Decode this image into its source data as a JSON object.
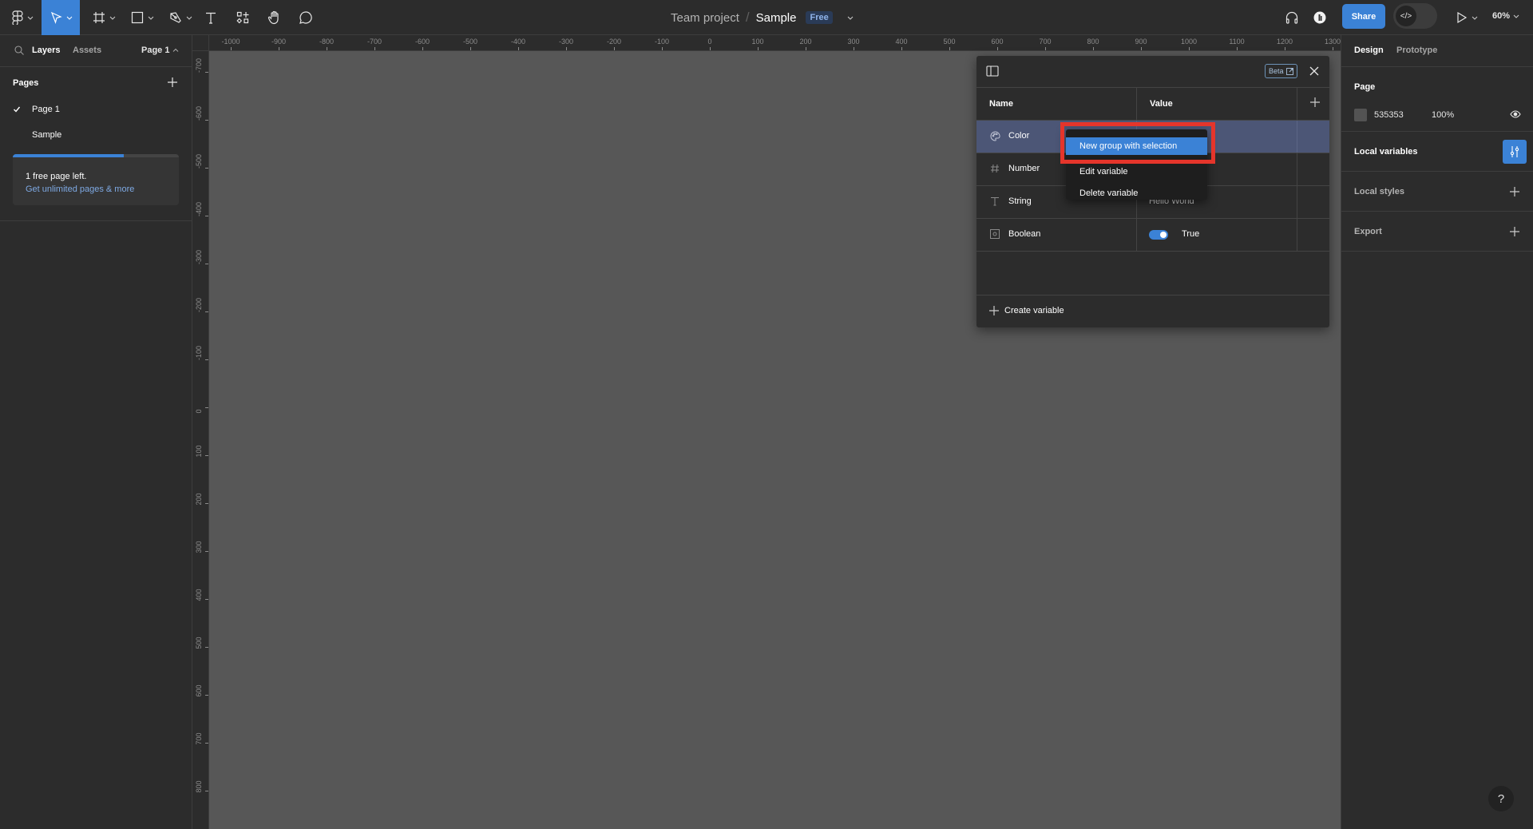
{
  "topbar": {
    "tools": [
      {
        "name": "main-menu",
        "icon": "figma-logo-icon"
      },
      {
        "name": "move",
        "icon": "move-cursor-icon",
        "active": true
      },
      {
        "name": "frame",
        "icon": "frame-icon"
      },
      {
        "name": "shape",
        "icon": "rectangle-icon"
      },
      {
        "name": "pen",
        "icon": "pen-icon"
      },
      {
        "name": "text",
        "icon": "text-icon"
      },
      {
        "name": "resources",
        "icon": "resources-icon"
      },
      {
        "name": "hand",
        "icon": "hand-icon"
      },
      {
        "name": "comment",
        "icon": "comment-icon"
      }
    ],
    "breadcrumb": {
      "project": "Team project",
      "separator": "/",
      "file": "Sample",
      "plan_badge": "Free"
    },
    "share_label": "Share",
    "devmode_icon": "</>",
    "zoom_level": "60%",
    "accent_color": "#3b82d6"
  },
  "left_panel": {
    "tabs": {
      "layers": "Layers",
      "assets": "Assets"
    },
    "current_page": "Page 1",
    "pages_heading": "Pages",
    "pages": [
      {
        "label": "Page 1",
        "selected": true
      },
      {
        "label": "Sample",
        "selected": false
      }
    ],
    "upsell": {
      "progress_fraction": 0.67,
      "line1": "1 free page left.",
      "line2": "Get unlimited pages & more"
    }
  },
  "rulers": {
    "horizontal": [
      "-1000",
      "-900",
      "-800",
      "-700",
      "-600",
      "-500",
      "-400",
      "-300",
      "-200",
      "-100",
      "0",
      "100",
      "200",
      "300",
      "400",
      "500",
      "600",
      "700",
      "800",
      "900",
      "1000",
      "1100",
      "1200",
      "1300"
    ],
    "vertical": [
      "-700",
      "-600",
      "-500",
      "-400",
      "-300",
      "-200",
      "-100",
      "0",
      "100",
      "200",
      "300",
      "400",
      "500",
      "600",
      "700",
      "800"
    ]
  },
  "variables_dialog": {
    "beta_label": "Beta",
    "columns": {
      "name": "Name",
      "value": "Value"
    },
    "rows": [
      {
        "type": "color",
        "icon": "palette-icon",
        "name": "Color",
        "value": "",
        "selected": true
      },
      {
        "type": "number",
        "icon": "hash-icon",
        "name": "Number",
        "value": ""
      },
      {
        "type": "string",
        "icon": "text-type-icon",
        "name": "String",
        "value": "Hello World"
      },
      {
        "type": "boolean",
        "icon": "boolean-icon",
        "name": "Boolean",
        "value": "True",
        "toggle_on": true
      }
    ],
    "create_label": "Create variable"
  },
  "context_menu": {
    "items": [
      {
        "label": "New group with selection",
        "highlighted": true
      },
      {
        "label": "Edit variable",
        "highlighted": false
      },
      {
        "label": "Delete variable",
        "highlighted": false
      }
    ],
    "annotation_color": "#e5352b"
  },
  "right_panel": {
    "tabs": {
      "design": "Design",
      "prototype": "Prototype"
    },
    "page_section": {
      "title": "Page",
      "bg_hex": "535353",
      "bg_color": "#535353",
      "opacity": "100%"
    },
    "local_variables": "Local variables",
    "local_styles": "Local styles",
    "export": "Export"
  },
  "help_label": "?"
}
